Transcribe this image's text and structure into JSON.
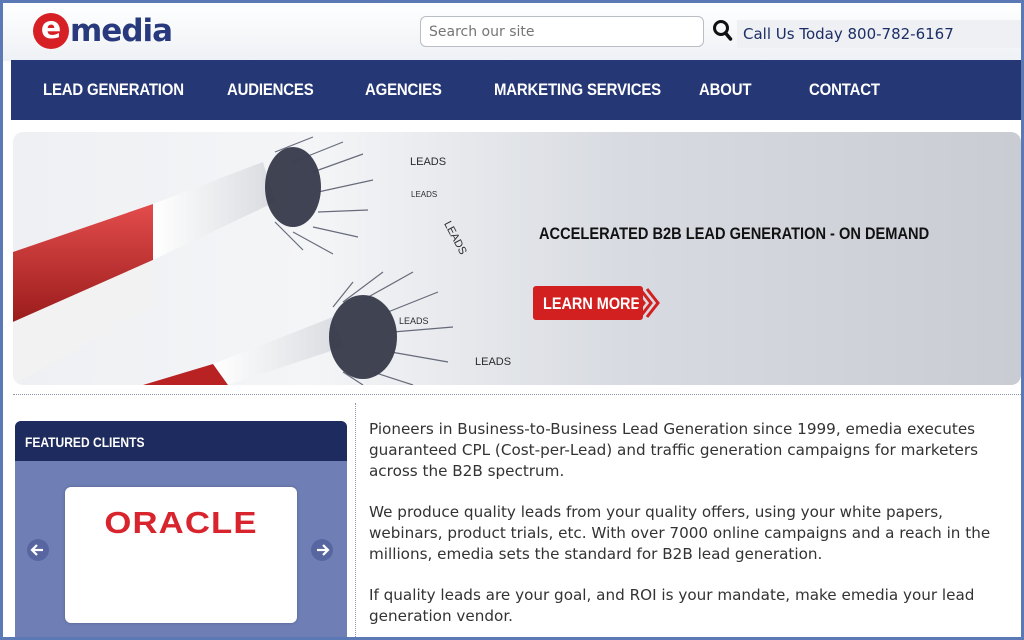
{
  "header": {
    "logo_letter": "e",
    "logo_text": "media",
    "search_placeholder": "Search our site",
    "call_us": "Call Us Today 800-782-6167"
  },
  "nav": {
    "items": [
      {
        "label": "LEAD GENERATION"
      },
      {
        "label": "AUDIENCES"
      },
      {
        "label": "AGENCIES"
      },
      {
        "label": "MARKETING SERVICES"
      },
      {
        "label": "ABOUT"
      },
      {
        "label": "CONTACT"
      }
    ]
  },
  "banner": {
    "headline": "ACCELERATED B2B LEAD GENERATION - ON DEMAND",
    "button_label": "LEARN MORE",
    "words": [
      "LEADS",
      "LEADS",
      "LEADS",
      "LEADS",
      "LEADS"
    ]
  },
  "featured": {
    "title": "FEATURED CLIENTS",
    "client_logo": "ORACLE"
  },
  "body": {
    "paragraphs": [
      "Pioneers in Business-to-Business Lead Generation since 1999, emedia executes guaranteed CPL (Cost-per-Lead) and traffic generation campaigns for marketers across the B2B spectrum.",
      "We produce quality leads from your quality offers, using your white papers, webinars, product trials, etc. With over 7000 online campaigns and a reach in the millions, emedia sets the standard for B2B lead generation.",
      "If quality leads are your goal, and ROI is your mandate, make emedia your lead generation vendor."
    ]
  },
  "colors": {
    "brand_red": "#d71f26",
    "brand_navy": "#263775",
    "featured_bg": "#6f7fb6",
    "frame_border": "#5b79b4"
  },
  "icons": [
    "search-icon",
    "magnet-graphic",
    "chevron-arrows-icon",
    "arrow-left-icon",
    "arrow-right-icon"
  ]
}
